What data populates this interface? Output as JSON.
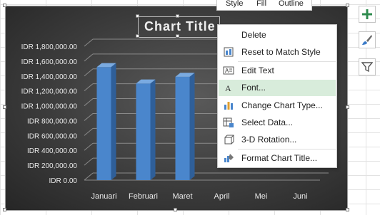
{
  "chart": {
    "title": "Chart Title"
  },
  "chart_data": {
    "type": "bar",
    "categories": [
      "Januari",
      "Februari",
      "Maret",
      "April",
      "Mei",
      "Juni"
    ],
    "values": [
      1520000,
      1300000,
      1390000,
      null,
      null,
      null
    ],
    "ylim": [
      0,
      1800000
    ],
    "yticks": [
      "IDR 0.00",
      "IDR 200,000.00",
      "IDR 400,000.00",
      "IDR 600,000.00",
      "IDR 800,000.00",
      "IDR 1,000,000.00",
      "IDR 1,200,000.00",
      "IDR 1,400,000.00",
      "IDR 1,600,000.00",
      "IDR 1,800,000.00"
    ],
    "grid": true,
    "style": "3d-column",
    "colors": {
      "bar": "#4a86cc",
      "background": "#3c3c3c",
      "text": "#e8e8e8"
    }
  },
  "mini_toolbar": {
    "style_label": "Style",
    "fill_label": "Fill",
    "outline_label": "Outline"
  },
  "context_menu": {
    "items": [
      {
        "label": "Delete",
        "icon": "none"
      },
      {
        "label": "Reset to Match Style",
        "icon": "reset-style-icon"
      },
      {
        "label": "Edit Text",
        "icon": "edit-text-icon"
      },
      {
        "label": "Font...",
        "icon": "font-icon"
      },
      {
        "label": "Change Chart Type...",
        "icon": "chart-type-icon"
      },
      {
        "label": "Select Data...",
        "icon": "select-data-icon"
      },
      {
        "label": "3-D Rotation...",
        "icon": "rotation-icon"
      },
      {
        "label": "Format Chart Title...",
        "icon": "format-icon"
      }
    ],
    "highlight_color": "#d8ecdb"
  },
  "side_buttons": [
    {
      "name": "chart-elements",
      "icon": "plus-icon"
    },
    {
      "name": "chart-styles",
      "icon": "brush-icon"
    },
    {
      "name": "chart-filters",
      "icon": "filter-icon"
    }
  ]
}
